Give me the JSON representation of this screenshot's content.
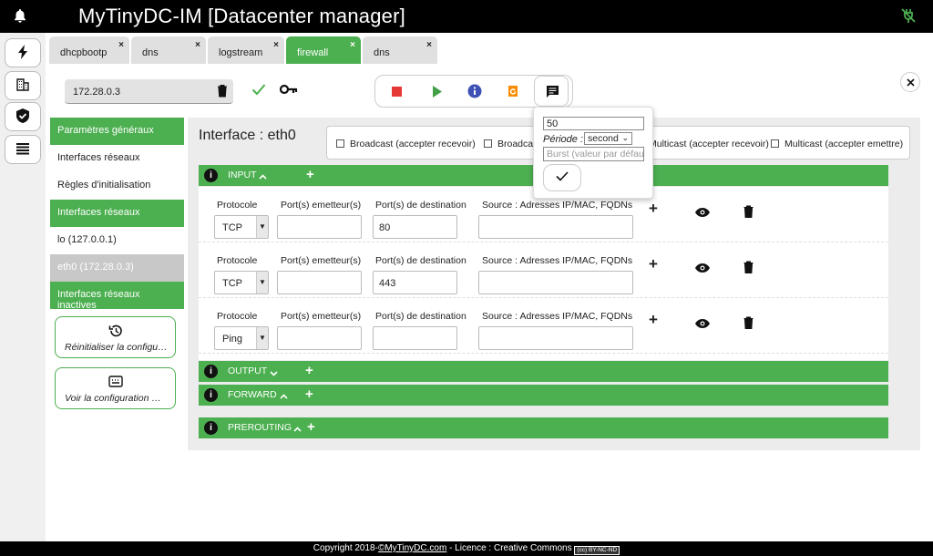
{
  "app": {
    "title": "MyTinyDC-IM [Datacenter manager]"
  },
  "tabs": [
    {
      "label": "dhcpbootp",
      "close": "×"
    },
    {
      "label": "dns",
      "close": "×"
    },
    {
      "label": "logstream",
      "close": "×"
    },
    {
      "label": "firewall",
      "close": "×"
    },
    {
      "label": "dns",
      "close": "×"
    }
  ],
  "host": {
    "ip": "172.28.0.3"
  },
  "sidebar": {
    "items": [
      {
        "label": "Paramètres généraux"
      },
      {
        "label": "Interfaces réseaux"
      },
      {
        "label": "Règles d'initialisation"
      },
      {
        "label": "Interfaces réseaux"
      },
      {
        "label": "lo (127.0.0.1)"
      },
      {
        "label": "eth0 (172.28.0.3)"
      },
      {
        "label": "Interfaces réseaux inactives"
      }
    ],
    "reset_label": "Réinitialiser la configuration",
    "view_label": "Voir la configuration mise en place"
  },
  "interface": {
    "title": "Interface : eth0"
  },
  "checks": [
    {
      "label": "Broadcast (accepter recevoir)"
    },
    {
      "label": "Broadcast (accepter emettre)"
    },
    {
      "label": "Multicast (accepter recevoir)"
    },
    {
      "label": "Multicast (accepter emettre)"
    }
  ],
  "sections": {
    "input": "INPUT",
    "output": "OUTPUT",
    "forward": "FORWARD",
    "prerouting": "PREROUTING"
  },
  "columns": {
    "protocol": "Protocole",
    "src_ports": "Port(s) emetteur(s)",
    "dst_ports": "Port(s) de destination",
    "source": "Source : Adresses IP/MAC, FQDNs"
  },
  "rules": [
    {
      "protocol": "TCP",
      "src_ports": "",
      "dst_ports": "80",
      "source": ""
    },
    {
      "protocol": "TCP",
      "src_ports": "",
      "dst_ports": "443",
      "source": ""
    },
    {
      "protocol": "Ping",
      "src_ports": "",
      "dst_ports": "",
      "source": ""
    }
  ],
  "popup": {
    "limit_value": "50",
    "period_label": "Période :",
    "period_value": "second",
    "burst_placeholder": "Burst (valeur par défaut)"
  },
  "footer": {
    "prefix": "Copyright 2018-",
    "link": "©MyTinyDC.com",
    "suffix": " - Licence : Creative Commons ",
    "badge": "(cc) BY-NC-ND"
  },
  "colors": {
    "accent": "#4caf50",
    "stop": "#e53935",
    "play": "#43a047",
    "info": "#3f51b5",
    "reload": "#fb8c00"
  }
}
